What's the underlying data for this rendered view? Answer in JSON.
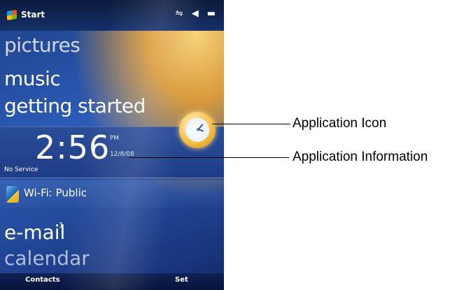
{
  "topbar": {
    "start_label": "Start",
    "status_icons": [
      "connectivity-icon",
      "volume-icon",
      "battery-icon"
    ]
  },
  "tiles": {
    "pictures": "pictures",
    "music": "music",
    "getting_started": "getting started"
  },
  "clock": {
    "time": "2:56",
    "ampm": "PM",
    "date": "12/8/08",
    "service": "No Service"
  },
  "wifi": {
    "label": "Wi-Fi: Public"
  },
  "email": {
    "label": "e-mail",
    "count": "1"
  },
  "calendar": {
    "label": "calendar"
  },
  "softkeys": {
    "left": "Contacts",
    "right": "Set"
  },
  "callouts": {
    "application_icon": "Application Icon",
    "application_information": "Application Information"
  }
}
